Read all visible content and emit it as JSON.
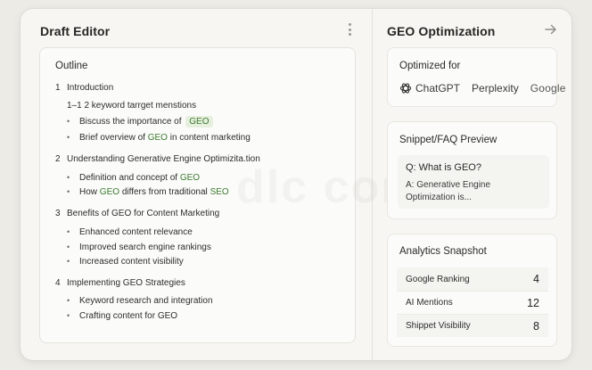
{
  "editor": {
    "title": "Draft Editor",
    "outline_label": "Outline",
    "sections": [
      {
        "num": "1",
        "title": "Introduction"
      },
      {
        "num": "2",
        "title": "Understanding Generative Engine Optimizita.tion"
      },
      {
        "num": "3",
        "title": "Benefits of GEO for Content Marketing"
      },
      {
        "num": "4",
        "title": "Implementing GEO Strategies"
      }
    ],
    "intro_note": "1–1 2 keyword tarrget menstions",
    "items": {
      "s1a_pre": "Biscuss the importance of",
      "s1a_geo": "GEO",
      "s1b_pre": "Brief overview of",
      "s1b_geo": "GEO",
      "s1b_post": "in content marketing",
      "s2a_pre": "Definition and concept of",
      "s2a_geo": "GEO",
      "s2b_pre": "How",
      "s2b_geo": "GEO",
      "s2b_mid": "differs from traditional",
      "s2b_seo": "SEO",
      "s3a": "Enhanced content relevance",
      "s3b": "Improved search engine rankings",
      "s3c": "Increased content visibility",
      "s4a": "Keyword research and integration",
      "s4b": "Crafting content for GEO"
    },
    "watermark": "dlc corp"
  },
  "geo": {
    "title": "GEO Optimization",
    "optimized_for": {
      "label": "Optimized for",
      "engines": [
        "ChatGPT",
        "Perplexity",
        "Google"
      ]
    },
    "snippet": {
      "title": "Snippet/FAQ Preview",
      "question": "Q: What is GEO?",
      "answer": "A: Generative Engine Optimization is..."
    },
    "analytics": {
      "title": "Analytics Snapshot",
      "metrics": [
        {
          "label": "Google Ranking",
          "value": "4"
        },
        {
          "label": "AI Mentions",
          "value": "12"
        },
        {
          "label": "Shippet Visibility",
          "value": "8"
        }
      ]
    }
  },
  "colors": {
    "accent_geo": "#3a7a2e",
    "chip_bg": "#e7f0df"
  },
  "icons": [
    "kebab-menu-icon",
    "arrow-right-icon",
    "openai-logo-icon"
  ]
}
